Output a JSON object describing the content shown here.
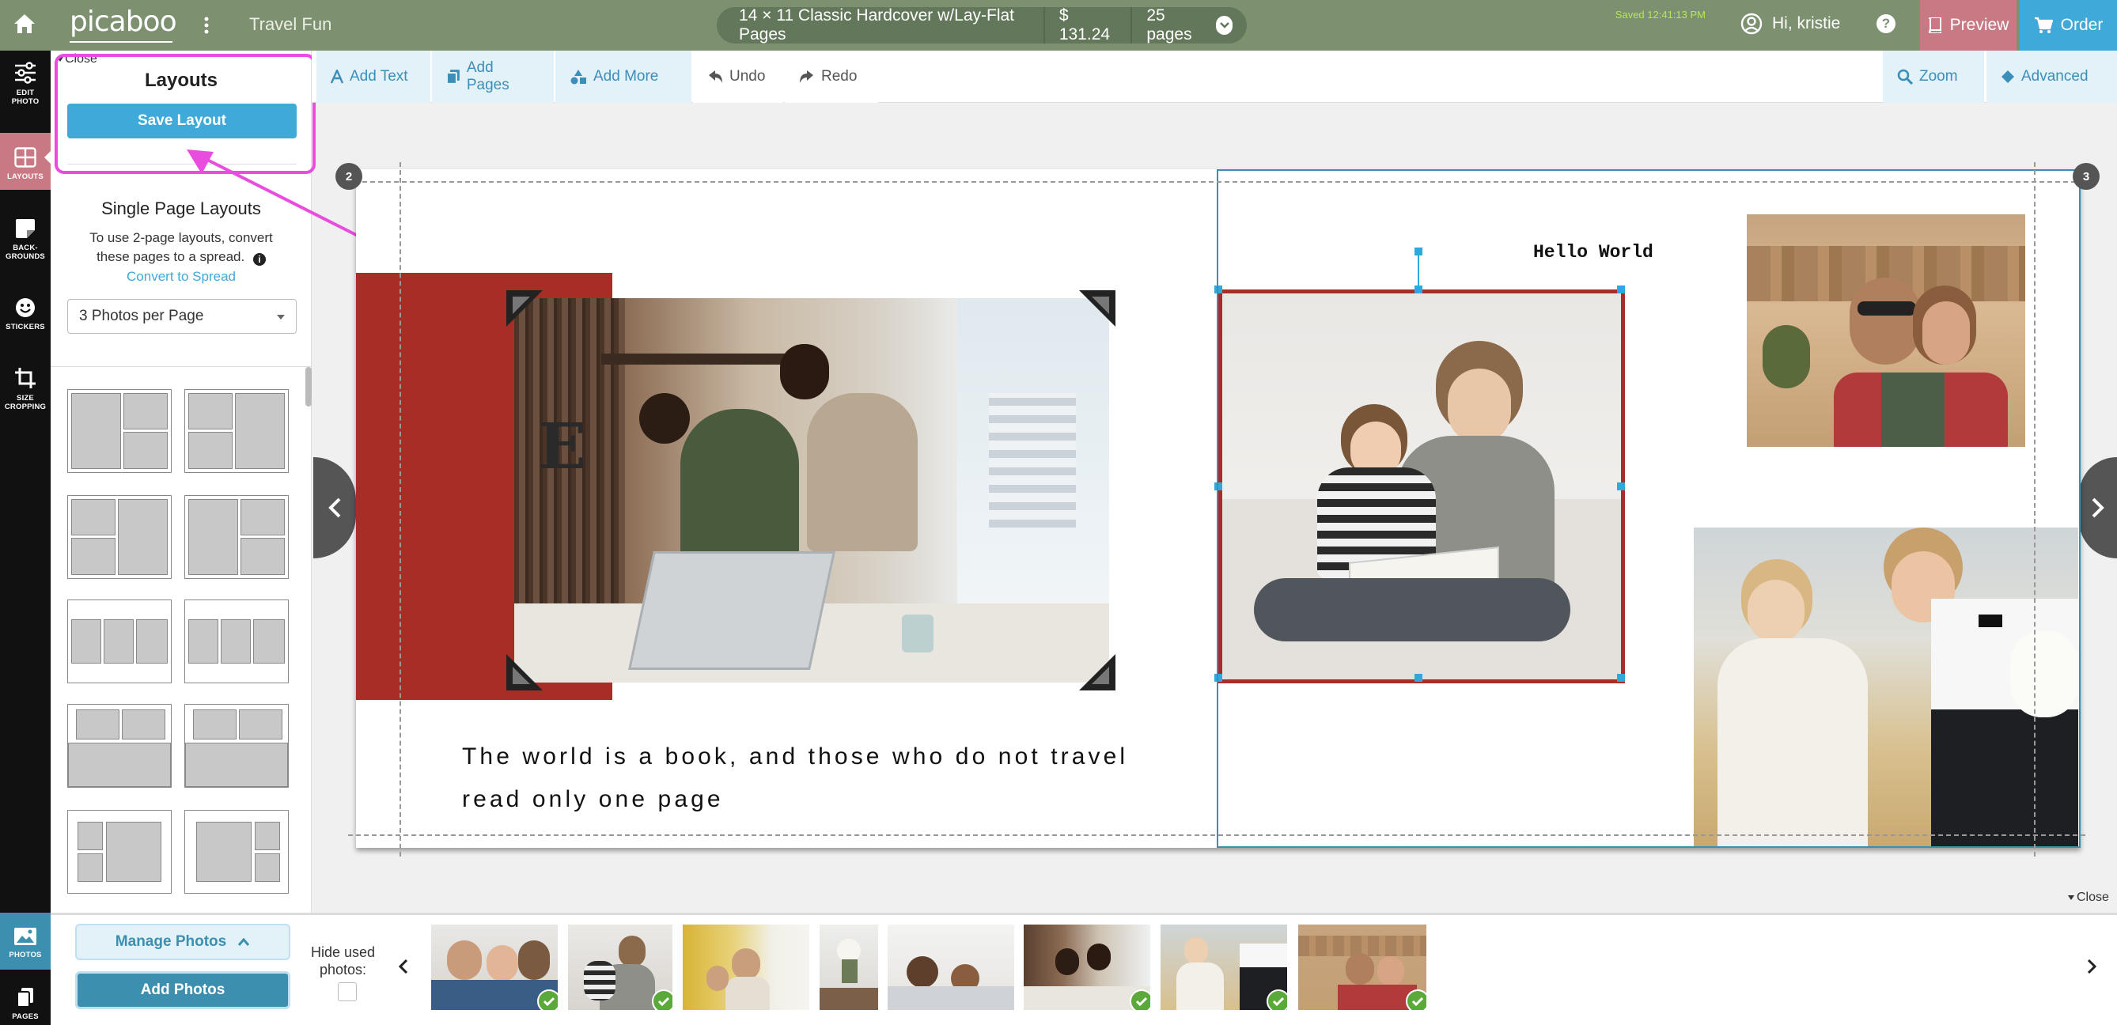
{
  "topbar": {
    "brand": "picaboo",
    "project_title": "Travel Fun",
    "product": "14 × 11 Classic Hardcover w/Lay-Flat Pages",
    "price": "$ 131.24",
    "pages": "25 pages",
    "saved_status": "Saved 12:41:13 PM",
    "greeting": "Hi, kristie",
    "help": "?",
    "preview_label": "Preview",
    "order_label": "Order"
  },
  "rail": {
    "edit_photo": "EDIT\nPHOTO",
    "layouts": "LAYOUTS",
    "backgrounds": "BACK-\nGROUNDS",
    "stickers": "STICKERS",
    "size_cropping": "SIZE\nCROPPING",
    "photos": "PHOTOS",
    "pages": "PAGES"
  },
  "panel": {
    "close_label": "Close",
    "title": "Layouts",
    "save_layout": "Save Layout",
    "section_title": "Single Page Layouts",
    "help_text_1": "To use 2-page layouts, convert",
    "help_text_2": "these pages to a spread.",
    "convert_link": "Convert to Spread",
    "select_value": "3 Photos per Page"
  },
  "toolbar": {
    "add_text": "Add Text",
    "add_pages": "Add Pages",
    "add_more": "Add More",
    "undo": "Undo",
    "redo": "Redo",
    "zoom": "Zoom",
    "advanced": "Advanced"
  },
  "canvas": {
    "left_page_number": "2",
    "right_page_number": "3",
    "quote_line_1": "The world is a book, and those who do not travel",
    "quote_line_2": "read only one page",
    "hello_text": "Hello World",
    "close_label": "Close"
  },
  "tray": {
    "manage_photos": "Manage Photos",
    "add_photos": "Add Photos",
    "hide_used_1": "Hide used",
    "hide_used_2": "photos:"
  },
  "colors": {
    "topbar": "#7d9170",
    "accent_blue": "#3fa9d9",
    "layouts_active": "#c97983",
    "order_blue": "#3fa9d9",
    "preview_pink": "#c97983",
    "highlight_magenta": "#e84de0",
    "red_block": "#a72d26"
  }
}
